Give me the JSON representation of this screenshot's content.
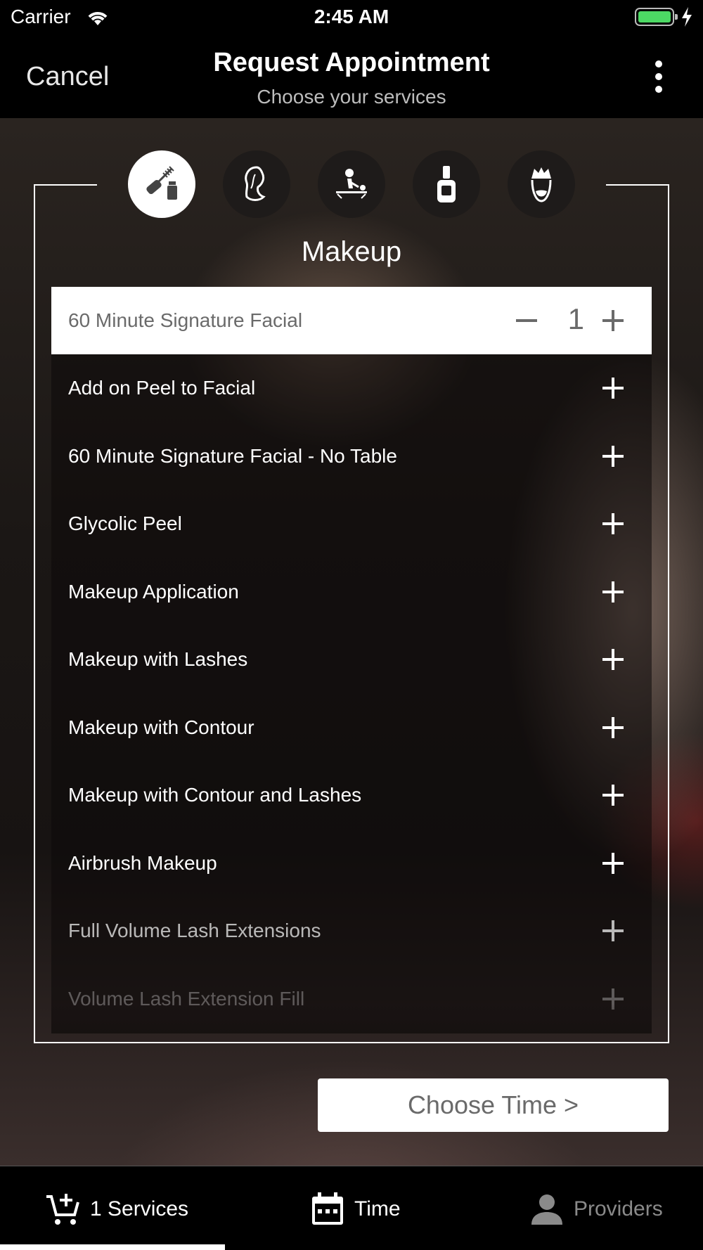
{
  "status_bar": {
    "carrier": "Carrier",
    "time": "2:45 AM"
  },
  "nav": {
    "cancel": "Cancel",
    "title": "Request Appointment",
    "subtitle": "Choose your services"
  },
  "categories": [
    {
      "icon": "mascara-icon",
      "active": true
    },
    {
      "icon": "hair-icon",
      "active": false
    },
    {
      "icon": "massage-icon",
      "active": false
    },
    {
      "icon": "nail-polish-icon",
      "active": false
    },
    {
      "icon": "barber-icon",
      "active": false
    }
  ],
  "category_title": "Makeup",
  "services": [
    {
      "label": "60 Minute Signature Facial",
      "quantity": "1",
      "selected": true
    },
    {
      "label": "Add on Peel to Facial"
    },
    {
      "label": "60 Minute Signature Facial - No Table"
    },
    {
      "label": "Glycolic Peel"
    },
    {
      "label": "Makeup Application"
    },
    {
      "label": "Makeup with Lashes"
    },
    {
      "label": "Makeup with Contour"
    },
    {
      "label": "Makeup with Contour and Lashes"
    },
    {
      "label": "Airbrush Makeup"
    },
    {
      "label": "Full Volume Lash Extensions"
    },
    {
      "label": "Volume Lash Extension Fill"
    }
  ],
  "choose_time": "Choose Time >",
  "tabs": [
    {
      "label": "1 Services",
      "icon": "cart-add-icon",
      "active": true
    },
    {
      "label": "Time",
      "icon": "calendar-icon"
    },
    {
      "label": "Providers",
      "icon": "person-icon"
    }
  ]
}
